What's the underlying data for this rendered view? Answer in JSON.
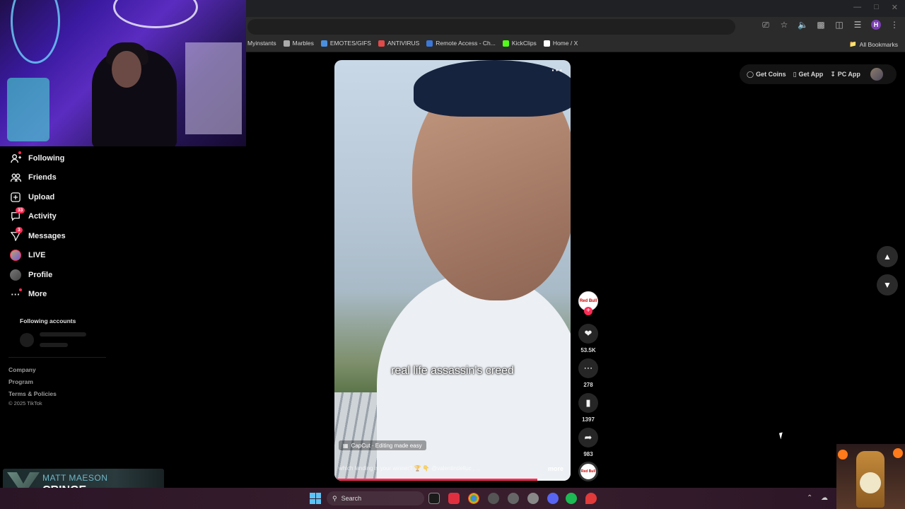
{
  "browser": {
    "bookmarks": [
      {
        "label": "Myinstants",
        "color": "#2b2b2b"
      },
      {
        "label": "Marbles",
        "color": "#aaaaaa"
      },
      {
        "label": "EMOTES/GIFS",
        "color": "#4a90e2"
      },
      {
        "label": "ANTIVIRUS",
        "color": "#e24a4a"
      },
      {
        "label": "Remote Access - Ch...",
        "color": "#3c78d8"
      },
      {
        "label": "KickClips",
        "color": "#53fc18"
      },
      {
        "label": "Home / X",
        "color": "#ffffff"
      }
    ],
    "all_bookmarks": "All Bookmarks",
    "profile_initial": "H"
  },
  "sidebar": {
    "items": [
      {
        "label": "Following",
        "icon": "following-icon"
      },
      {
        "label": "Friends",
        "icon": "friends-icon"
      },
      {
        "label": "Upload",
        "icon": "upload-icon"
      },
      {
        "label": "Activity",
        "icon": "activity-icon",
        "badge": "33"
      },
      {
        "label": "Messages",
        "icon": "messages-icon",
        "badge": "3"
      },
      {
        "label": "LIVE",
        "icon": "live-icon"
      },
      {
        "label": "Profile",
        "icon": "profile-icon"
      },
      {
        "label": "More",
        "icon": "more-icon"
      }
    ],
    "following_accounts": "Following accounts",
    "footer": [
      "Company",
      "Program",
      "Terms & Policies"
    ],
    "copyright": "© 2025 TikTok"
  },
  "header": {
    "get_coins": "Get Coins",
    "get_app": "Get App",
    "pc_app": "PC App"
  },
  "video": {
    "caption": "real life assassin's creed",
    "capcut": "CapCut · Editing made easy",
    "description": "which landing is your winner? 🏆 👇 @valentindelluc , ...",
    "more": "more",
    "progress": 0.86
  },
  "actions": {
    "likes": "53.5K",
    "comments": "278",
    "saves": "1397",
    "shares": "983"
  },
  "alert": {
    "title": "MATT MAESON",
    "subtitle": "CRINGE"
  },
  "taskbar": {
    "search": "Search"
  },
  "colors": {
    "accent": "#fe2c55"
  }
}
